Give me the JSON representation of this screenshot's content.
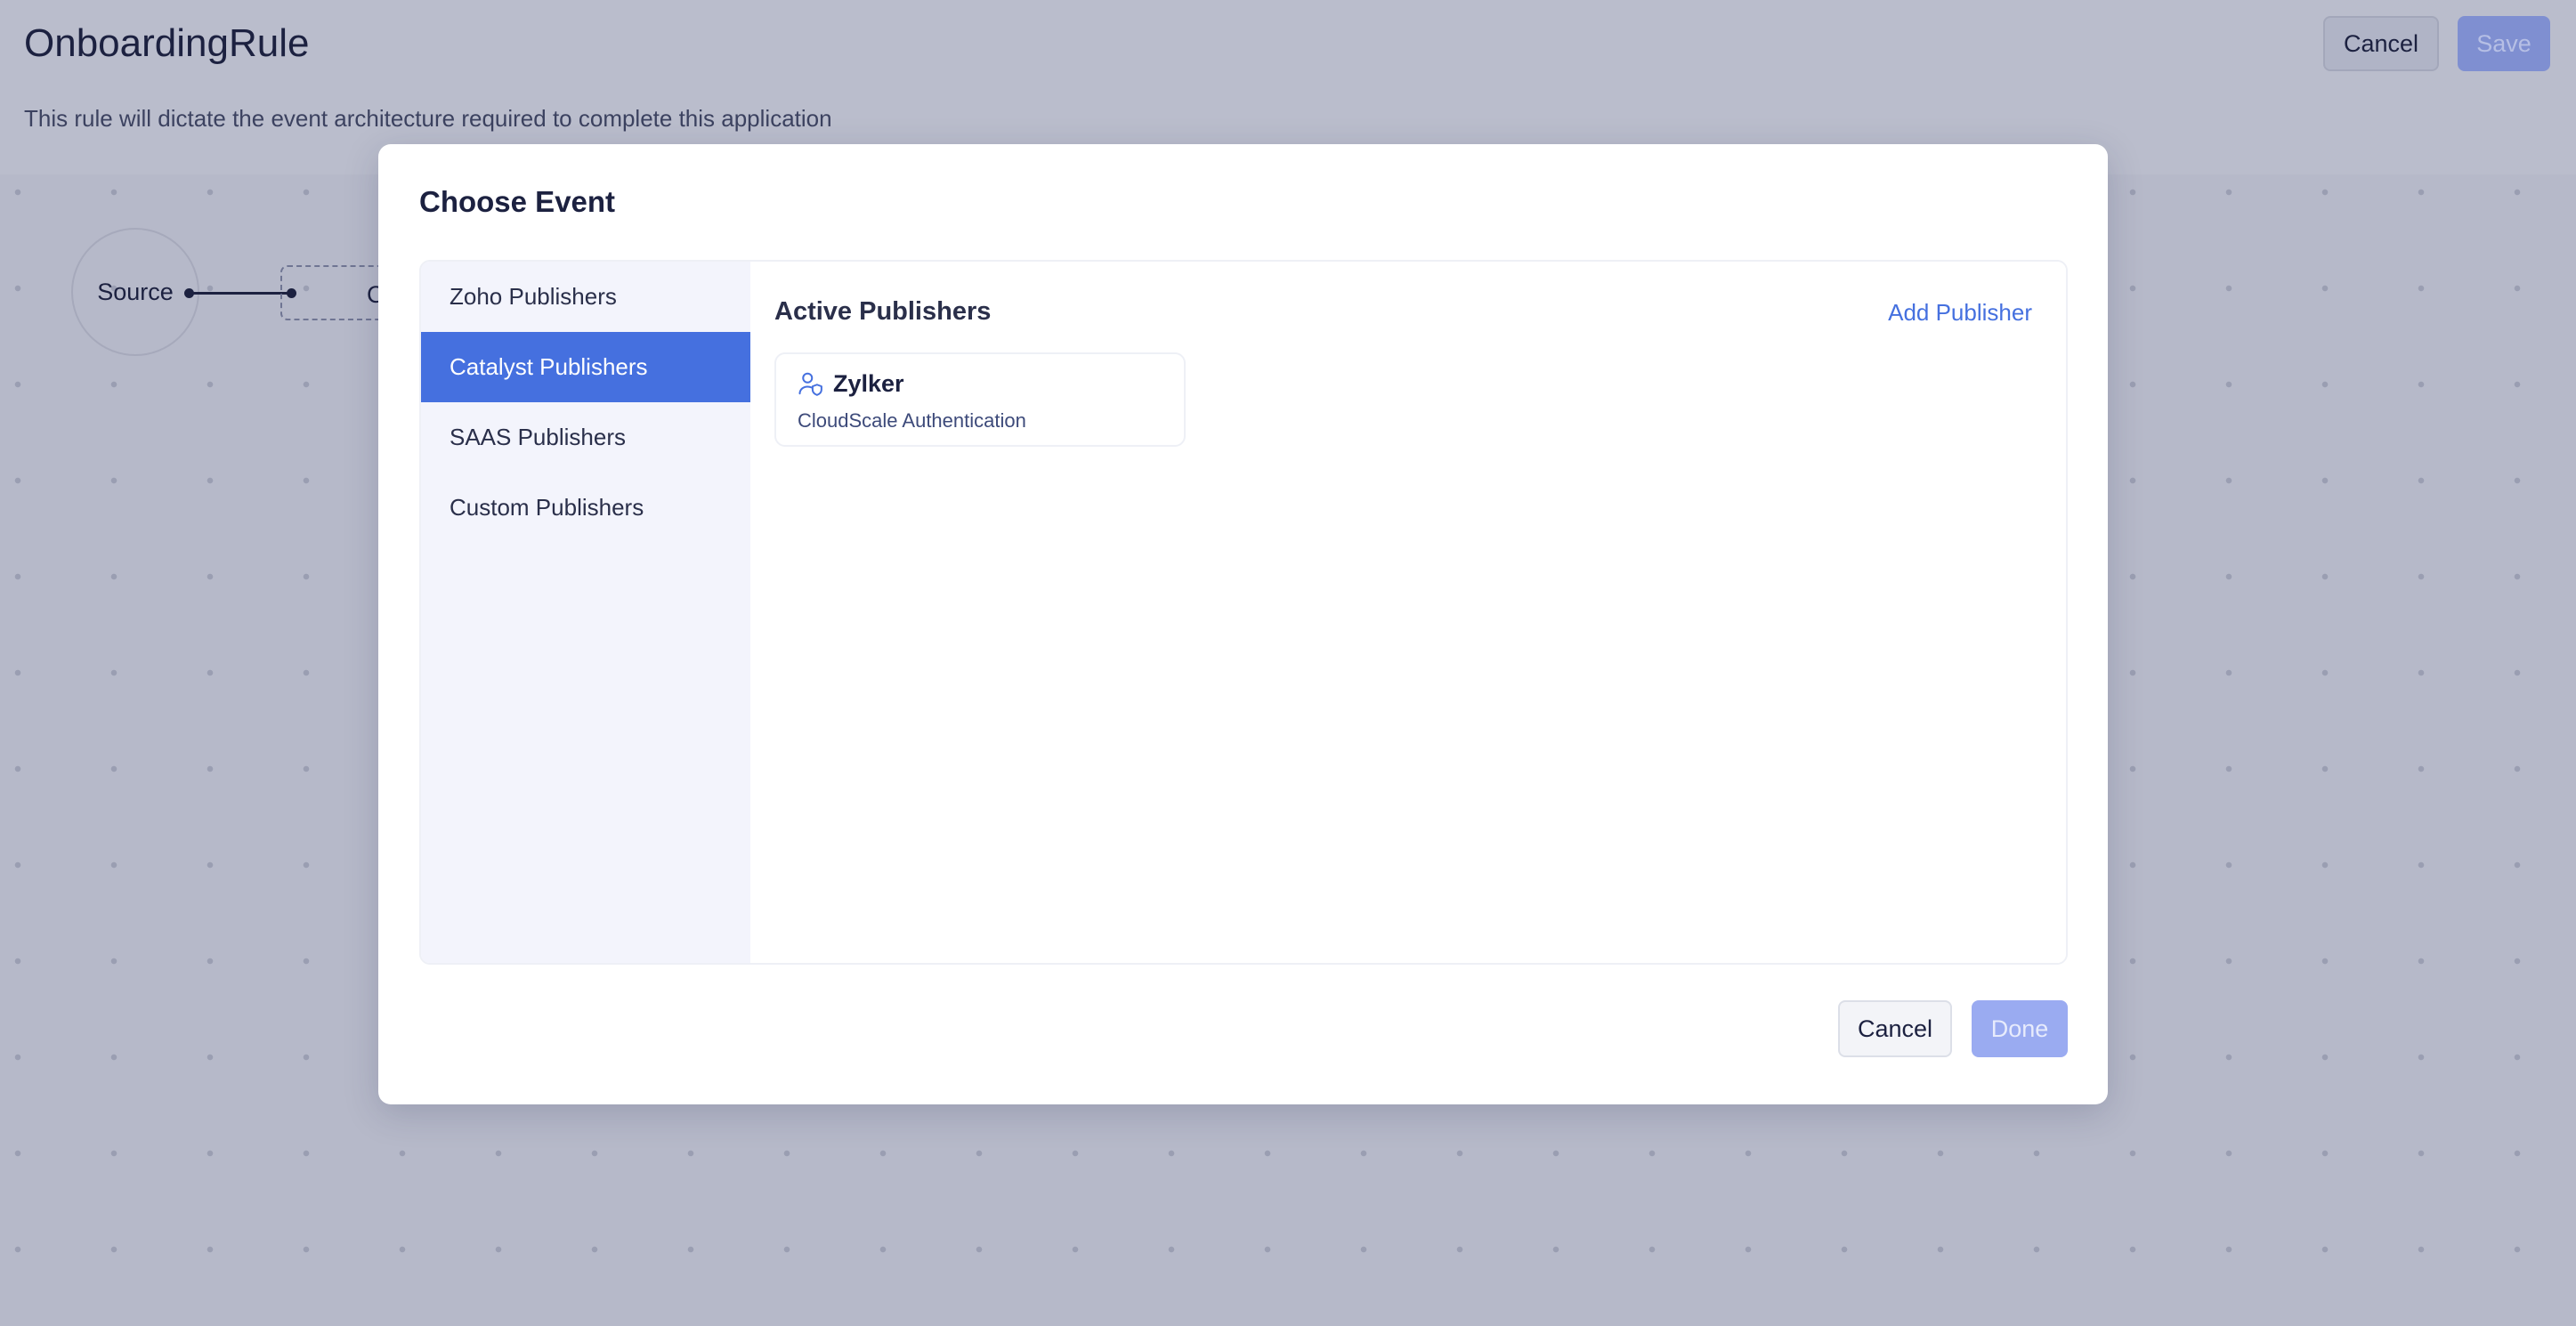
{
  "page": {
    "title": "OnboardingRule",
    "description": "This rule will dictate the event architecture required to complete this application",
    "cancel_label": "Cancel",
    "save_label": "Save"
  },
  "canvas": {
    "source_label": "Source",
    "next_node_label": "C"
  },
  "modal": {
    "title": "Choose Event",
    "sidebar": {
      "items": [
        {
          "label": "Zoho Publishers",
          "active": false
        },
        {
          "label": "Catalyst Publishers",
          "active": true
        },
        {
          "label": "SAAS Publishers",
          "active": false
        },
        {
          "label": "Custom Publishers",
          "active": false
        }
      ]
    },
    "content": {
      "title": "Active Publishers",
      "add_publisher_label": "Add Publisher",
      "publishers": [
        {
          "name": "Zylker",
          "subtitle": "CloudScale Authentication",
          "icon": "user-shield-icon"
        }
      ]
    },
    "cancel_label": "Cancel",
    "done_label": "Done"
  },
  "colors": {
    "accent": "#4570df",
    "overlay": "#b6b9c9",
    "done_disabled": "#9aabf1"
  }
}
